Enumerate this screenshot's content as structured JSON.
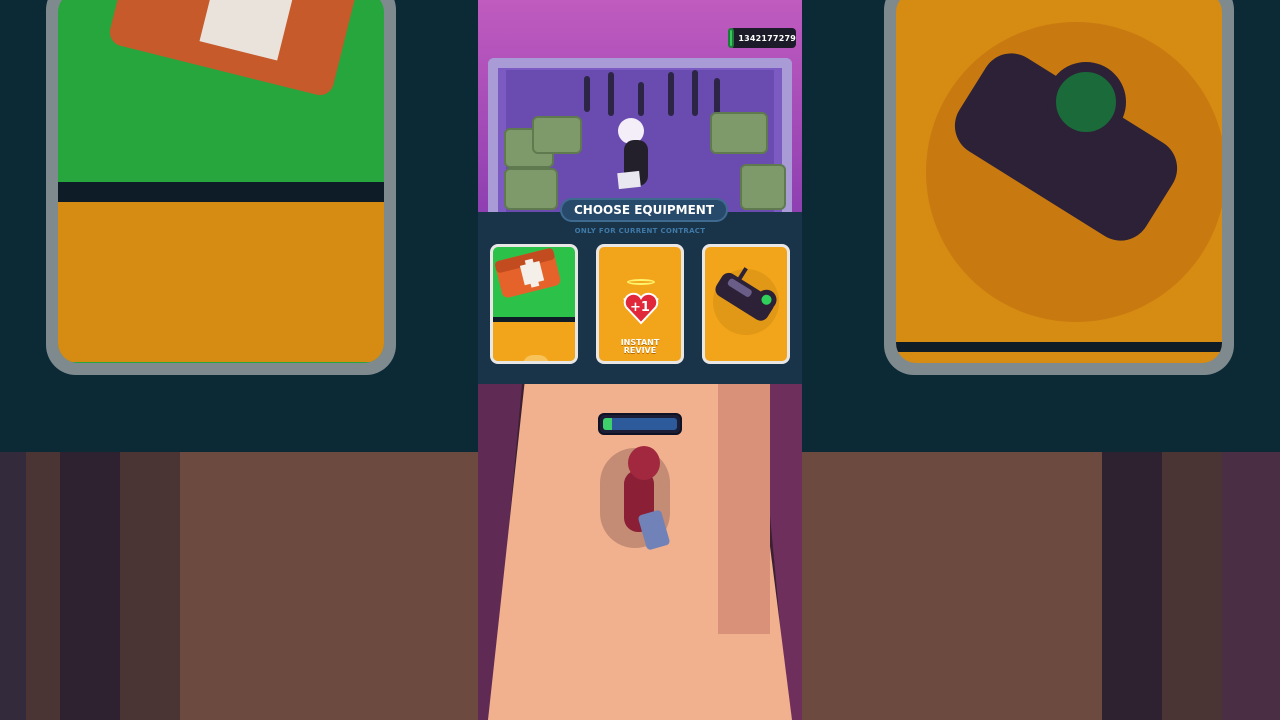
{
  "hud": {
    "money": "1342177279",
    "money_icon": "cash-icon"
  },
  "panel": {
    "title": "CHOOSE EQUIPMENT",
    "subtitle": "ONLY FOR CURRENT CONTRACT"
  },
  "equipment": [
    {
      "icon": "medkit-icon",
      "label": ""
    },
    {
      "icon": "winged-heart-icon",
      "badge": "+1",
      "label_line1": "INSTANT",
      "label_line2": "REVIVE"
    },
    {
      "icon": "night-vision-goggles-icon",
      "label": ""
    }
  ],
  "progress": {
    "value": 0.12
  },
  "colors": {
    "panel": "#193348",
    "card_orange": "#f2a51a",
    "card_green": "#2cc24a",
    "money_green": "#38c75a",
    "progress_green": "#3ed06a"
  }
}
